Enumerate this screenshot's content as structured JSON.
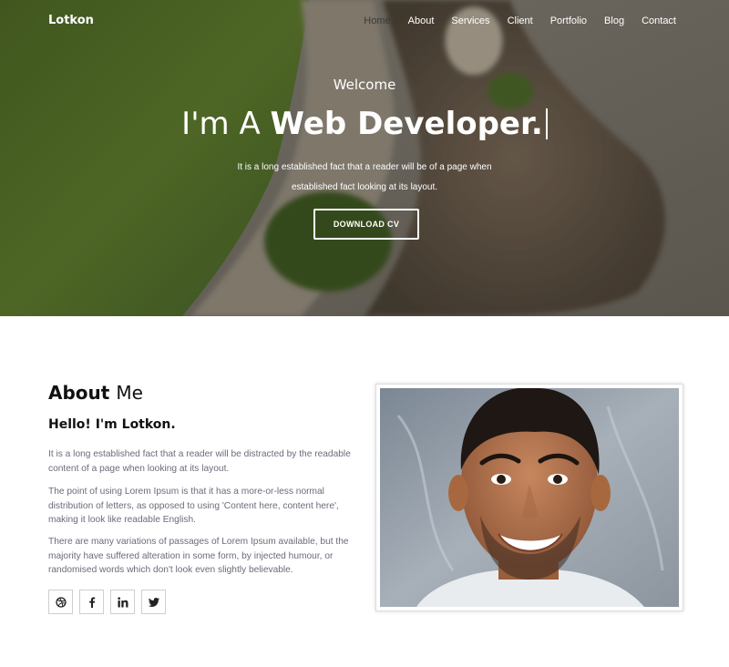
{
  "nav": {
    "logo": "Lotkon",
    "items": [
      "Home",
      "About",
      "Services",
      "Client",
      "Portfolio",
      "Blog",
      "Contact"
    ],
    "active": "Home"
  },
  "hero": {
    "welcome": "Welcome",
    "headline_light": "I'm A",
    "headline_bold": "Web Developer.",
    "text_line1": "It is a long established fact that a reader will be of a page when",
    "text_line2": "established fact looking at its layout.",
    "button_label": "DOWNLOAD CV"
  },
  "about": {
    "title_bold": "About",
    "title_light": "Me",
    "hello_prefix": "Hello!",
    "hello_name": "I'm Lotkon.",
    "paragraphs": [
      "It is a long established fact that a reader will be distracted by the readable content of a page when looking at its layout.",
      "The point of using Lorem Ipsum is that it has a more-or-less normal distribution of letters, as opposed to using 'Content here, content here', making it look like readable English.",
      "There are many variations of passages of Lorem Ipsum available, but the majority have suffered alteration in some form, by injected humour, or randomised words which don't look even slightly believable."
    ],
    "socials": [
      {
        "icon": "dribbble-icon",
        "glyph": "◎"
      },
      {
        "icon": "facebook-icon",
        "glyph": "f"
      },
      {
        "icon": "linkedin-icon",
        "glyph": "in"
      },
      {
        "icon": "twitter-icon",
        "glyph": "🐦"
      }
    ]
  },
  "colors": {
    "text_gray": "#6b6b7b",
    "active_nav": "#3a3a3a"
  }
}
